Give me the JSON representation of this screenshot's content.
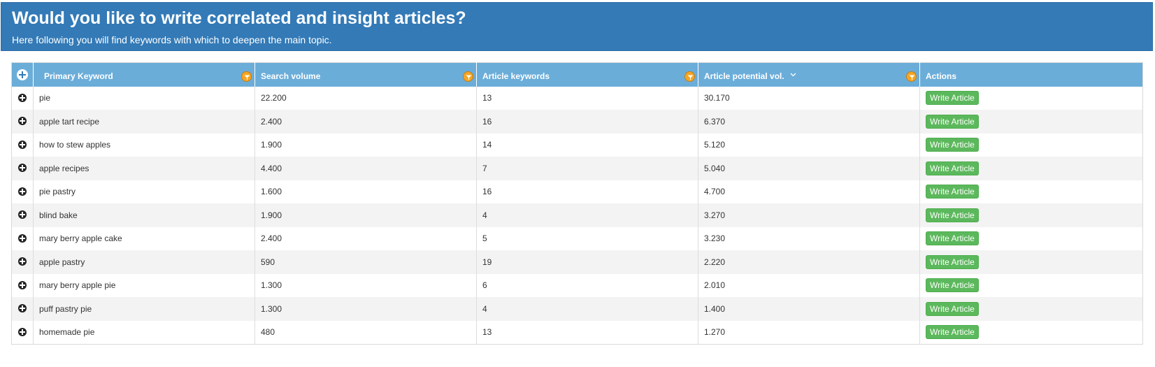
{
  "banner": {
    "title": "Would you like to write correlated and insight articles?",
    "subtitle": "Here following you will find keywords with which to deepen the main topic."
  },
  "table": {
    "columns": {
      "expand_icon": "plus-circle-icon",
      "primary_keyword": "Primary Keyword",
      "search_volume": "Search volume",
      "article_keywords": "Article keywords",
      "article_potential": "Article potential vol.",
      "actions": "Actions"
    },
    "sort_column": "Article potential vol.",
    "sort_direction": "descending",
    "filter_icon_color": "#f5a623",
    "header_color": "#6badd9",
    "button_color": "#5cb85c",
    "rows": [
      {
        "keyword": "pie",
        "volume": "22.200",
        "article_keywords": "13",
        "potential": "30.170",
        "action": "Write Article"
      },
      {
        "keyword": "apple tart recipe",
        "volume": "2.400",
        "article_keywords": "16",
        "potential": "6.370",
        "action": "Write Article"
      },
      {
        "keyword": "how to stew apples",
        "volume": "1.900",
        "article_keywords": "14",
        "potential": "5.120",
        "action": "Write Article"
      },
      {
        "keyword": "apple recipes",
        "volume": "4.400",
        "article_keywords": "7",
        "potential": "5.040",
        "action": "Write Article"
      },
      {
        "keyword": "pie pastry",
        "volume": "1.600",
        "article_keywords": "16",
        "potential": "4.700",
        "action": "Write Article"
      },
      {
        "keyword": "blind bake",
        "volume": "1.900",
        "article_keywords": "4",
        "potential": "3.270",
        "action": "Write Article"
      },
      {
        "keyword": "mary berry apple cake",
        "volume": "2.400",
        "article_keywords": "5",
        "potential": "3.230",
        "action": "Write Article"
      },
      {
        "keyword": "apple pastry",
        "volume": "590",
        "article_keywords": "19",
        "potential": "2.220",
        "action": "Write Article"
      },
      {
        "keyword": "mary berry apple pie",
        "volume": "1.300",
        "article_keywords": "6",
        "potential": "2.010",
        "action": "Write Article"
      },
      {
        "keyword": "puff pastry pie",
        "volume": "1.300",
        "article_keywords": "4",
        "potential": "1.400",
        "action": "Write Article"
      },
      {
        "keyword": "homemade pie",
        "volume": "480",
        "article_keywords": "13",
        "potential": "1.270",
        "action": "Write Article"
      }
    ]
  }
}
